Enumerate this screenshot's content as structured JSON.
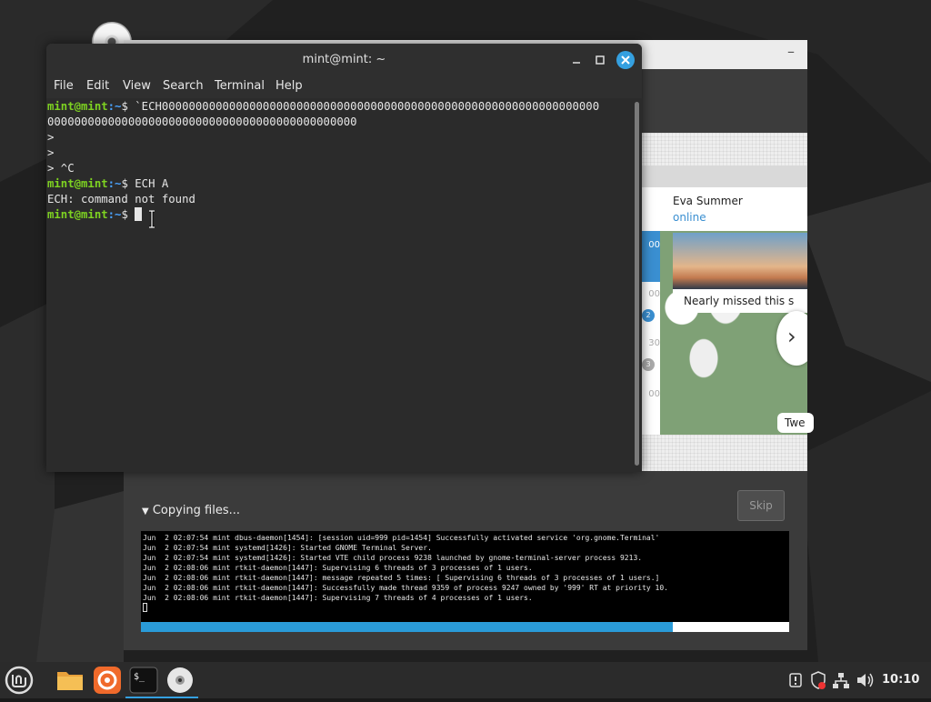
{
  "terminal": {
    "title": "mint@mint: ~",
    "menu": [
      "File",
      "Edit",
      "View",
      "Search",
      "Terminal",
      "Help"
    ],
    "prompt_user": "mint@mint",
    "prompt_path": ":~",
    "prompt_symbol": "$ ",
    "lines": {
      "l1_cmd": "`ECH00000000000000000000000000000000000000000000000000000000000000000",
      "l2_text": "0000000000000000000000000000000000000000000000",
      "l3_text": ">",
      "l4_text": ">",
      "l5_text": "> ^C",
      "l6_cmd": "ECH A",
      "l7_text": "ECH: command not found",
      "l8_cmd": ""
    }
  },
  "installer": {
    "slideshow": {
      "contact_name": "Eva Summer",
      "contact_status": "online",
      "photo_caption": "Nearly missed this s",
      "bubble_text": "Twe",
      "sidebar_numbers": [
        "00",
        "00",
        "30",
        "00"
      ],
      "badge_2": "2",
      "badge_3": "3"
    },
    "copy_label": "Copying files...",
    "skip_label": "Skip",
    "log_lines": [
      "Jun  2 02:07:54 mint dbus-daemon[1454]: [session uid=999 pid=1454] Successfully activated service 'org.gnome.Terminal'",
      "Jun  2 02:07:54 mint systemd[1426]: Started GNOME Terminal Server.",
      "Jun  2 02:07:54 mint systemd[1426]: Started VTE child process 9238 launched by gnome-terminal-server process 9213.",
      "Jun  2 02:08:06 mint rtkit-daemon[1447]: Supervising 6 threads of 3 processes of 1 users.",
      "Jun  2 02:08:06 mint rtkit-daemon[1447]: message repeated 5 times: [ Supervising 6 threads of 3 processes of 1 users.]",
      "Jun  2 02:08:06 mint rtkit-daemon[1447]: Successfully made thread 9359 of process 9247 owned by '999' RT at priority 10.",
      "Jun  2 02:08:06 mint rtkit-daemon[1447]: Supervising 7 threads of 4 processes of 1 users."
    ],
    "progress": 0.82
  },
  "taskbar": {
    "clock": "10:10",
    "apps": [
      "mint-menu-icon",
      "files-icon",
      "firefox-icon",
      "terminal-icon",
      "install-disc-icon"
    ],
    "terminal_glyph": "$_"
  },
  "colors": {
    "accent": "#35a0e0",
    "prompt_green": "#7ed321",
    "prompt_blue": "#4aa3ff"
  }
}
